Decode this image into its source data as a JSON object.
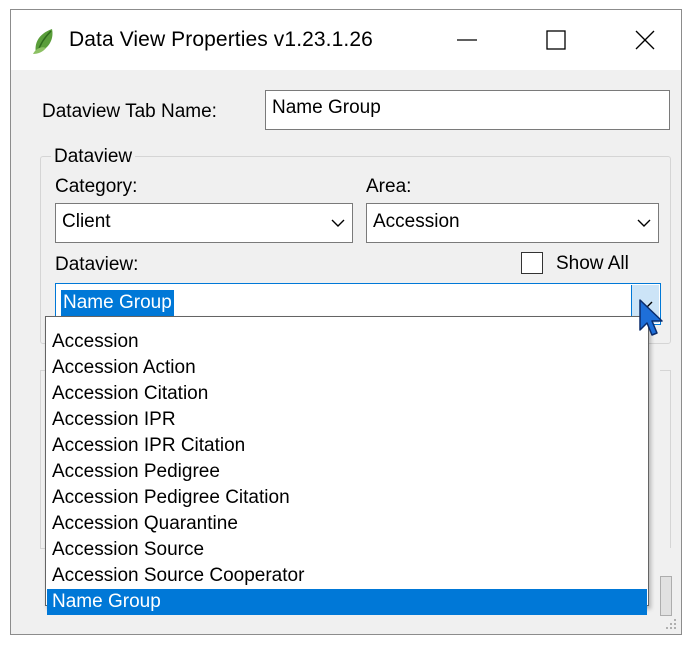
{
  "window": {
    "title": "Data View Properties v1.23.1.26",
    "icon": "green-leaf-app-icon",
    "controls": [
      "minimize-icon",
      "maximize-icon",
      "close-icon"
    ]
  },
  "tab_name": {
    "label": "Dataview Tab Name:",
    "value": "Name Group"
  },
  "dataview_group": {
    "title": "Dataview",
    "category": {
      "label": "Category:",
      "value": "Client"
    },
    "area": {
      "label": "Area:",
      "value": "Accession"
    },
    "dataview": {
      "label": "Dataview:",
      "value": "Name Group"
    },
    "show_all": {
      "label": "Show All",
      "checked": false
    }
  },
  "dropdown": {
    "items": [
      "Accession",
      "Accession Action",
      "Accession Citation",
      "Accession IPR",
      "Accession IPR Citation",
      "Accession Pedigree",
      "Accession Pedigree Citation",
      "Accession Quarantine",
      "Accession Source",
      "Accession Source Cooperator",
      "Name Group"
    ],
    "selected_index": 10
  },
  "colors": {
    "accent": "#0078d7",
    "dialog_bg": "#f0f0f0",
    "dropdown_button_hover": "#cce4f7"
  }
}
